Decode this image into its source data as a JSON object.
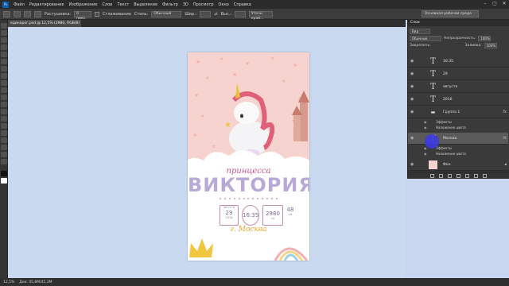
{
  "menu": [
    "Файл",
    "Редактирование",
    "Изображение",
    "Слои",
    "Текст",
    "Выделение",
    "Фильтр",
    "3D",
    "Просмотр",
    "Окно",
    "Справка"
  ],
  "options": {
    "feather_label": "Растушевка:",
    "feather_value": "0 пикс.",
    "antialias_label": "Сглаживание",
    "style_label": "Стиль:",
    "style_value": "Обычный",
    "width_label": "Шир.:",
    "height_label": "Выс.:",
    "refine_label": "Уточн. край...",
    "workspace": "Основная рабочая среда"
  },
  "document_tab": "единорог.psd @ 12,5% (2980, RGB/8) *",
  "layers_panel": {
    "tab": "Слои",
    "filter_label": "Вид",
    "blend_mode": "Обычные",
    "opacity_label": "Непрозрачность:",
    "opacity_value": "100%",
    "lock_label": "Закрепить:",
    "fill_label": "Заливка:",
    "fill_value": "100%",
    "layers": [
      {
        "name": "16:35",
        "type": "text"
      },
      {
        "name": "29",
        "type": "text"
      },
      {
        "name": "августа",
        "type": "text"
      },
      {
        "name": "2016",
        "type": "text"
      },
      {
        "name": "Группа 1",
        "type": "group"
      },
      {
        "name": "Москва",
        "type": "text"
      },
      {
        "name": "Фон",
        "type": "image"
      }
    ],
    "effects_label": "Эффекты",
    "color_overlay_label": "Наложение цвета"
  },
  "poster": {
    "subtitle": "принцесса",
    "name": "ВИКТОРИЯ",
    "month": "августа",
    "day": "29",
    "year": "2016",
    "time": "16:35",
    "weight": "2980",
    "weight_unit": "гр",
    "height": "48",
    "height_unit": "см",
    "city": "г. Москва"
  },
  "status": {
    "zoom": "12,5%",
    "doc_size": "Док: 45,8M/45,3M"
  },
  "colors": {
    "canvas_bg": "#c9d9f0",
    "poster_pink": "#f7d3cf",
    "name_lilac": "#b8aad6",
    "accent_pink": "#c55a8a",
    "city_gold": "#e5a832"
  }
}
